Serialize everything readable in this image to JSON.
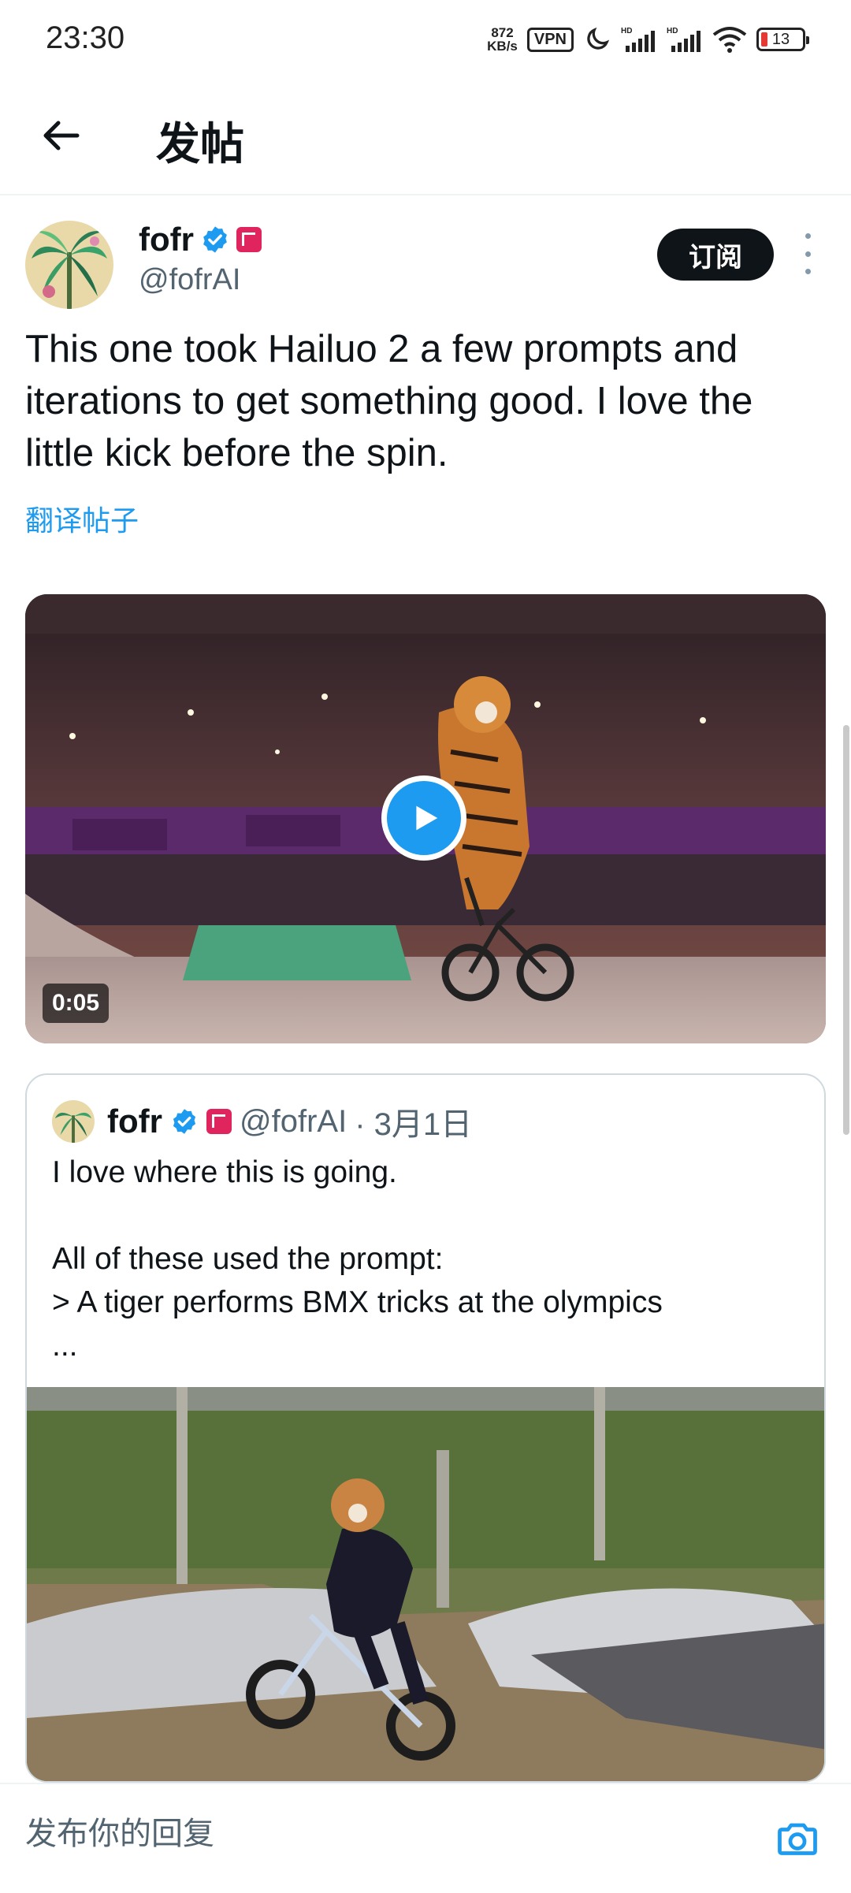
{
  "status_bar": {
    "time": "23:30",
    "speed_value": "872",
    "speed_unit": "KB/s",
    "vpn": "VPN",
    "battery": "13"
  },
  "header": {
    "title": "发帖",
    "back_icon": "back-arrow-icon"
  },
  "post": {
    "author_name": "fofr",
    "author_handle": "@fofrAI",
    "subscribe_label": "订阅",
    "text": "This one took Hailuo 2 a few prompts and iterations to get something good. I love the little kick before the spin.",
    "translate_label": "翻译帖子",
    "video": {
      "duration": "0:05",
      "play_icon": "play-icon"
    }
  },
  "quoted_post": {
    "author_name": "fofr",
    "author_handle": "@fofrAI",
    "date": "· 3月1日",
    "text": "I love where this is going.\n\nAll of these used the prompt:\n> A tiger performs BMX tricks at the olympics\n..."
  },
  "reply_bar": {
    "placeholder": "发布你的回复",
    "camera_icon": "camera-icon"
  },
  "colors": {
    "accent": "#1d9bf0",
    "text_primary": "#0f1419",
    "text_secondary": "#536471"
  }
}
